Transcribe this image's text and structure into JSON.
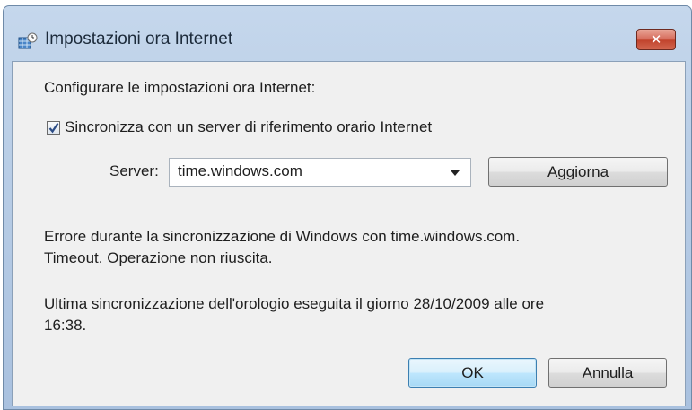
{
  "window": {
    "title": "Impostazioni ora Internet",
    "close_label": "✕"
  },
  "content": {
    "heading": "Configurare le impostazioni ora Internet:",
    "sync_checkbox": {
      "label": "Sincronizza con un server di riferimento orario Internet",
      "checked": true
    },
    "server": {
      "label": "Server:",
      "value": "time.windows.com"
    },
    "update_button": "Aggiorna",
    "error_line1": "Errore durante la sincronizzazione di Windows con time.windows.com.",
    "error_line2": "Timeout. Operazione non riuscita.",
    "last_sync_line1": "Ultima sincronizzazione dell'orologio eseguita il giorno 28/10/2009 alle ore",
    "last_sync_line2": "16:38."
  },
  "buttons": {
    "ok": "OK",
    "cancel": "Annulla"
  },
  "colors": {
    "client_bg": "#f0f0f0",
    "close_button": "#c1442d",
    "default_button_border": "#3c7fb1"
  },
  "icons": {
    "title": "clock-globe-icon",
    "close": "close-icon",
    "check": "checkmark-icon",
    "dropdown": "chevron-down-icon"
  }
}
